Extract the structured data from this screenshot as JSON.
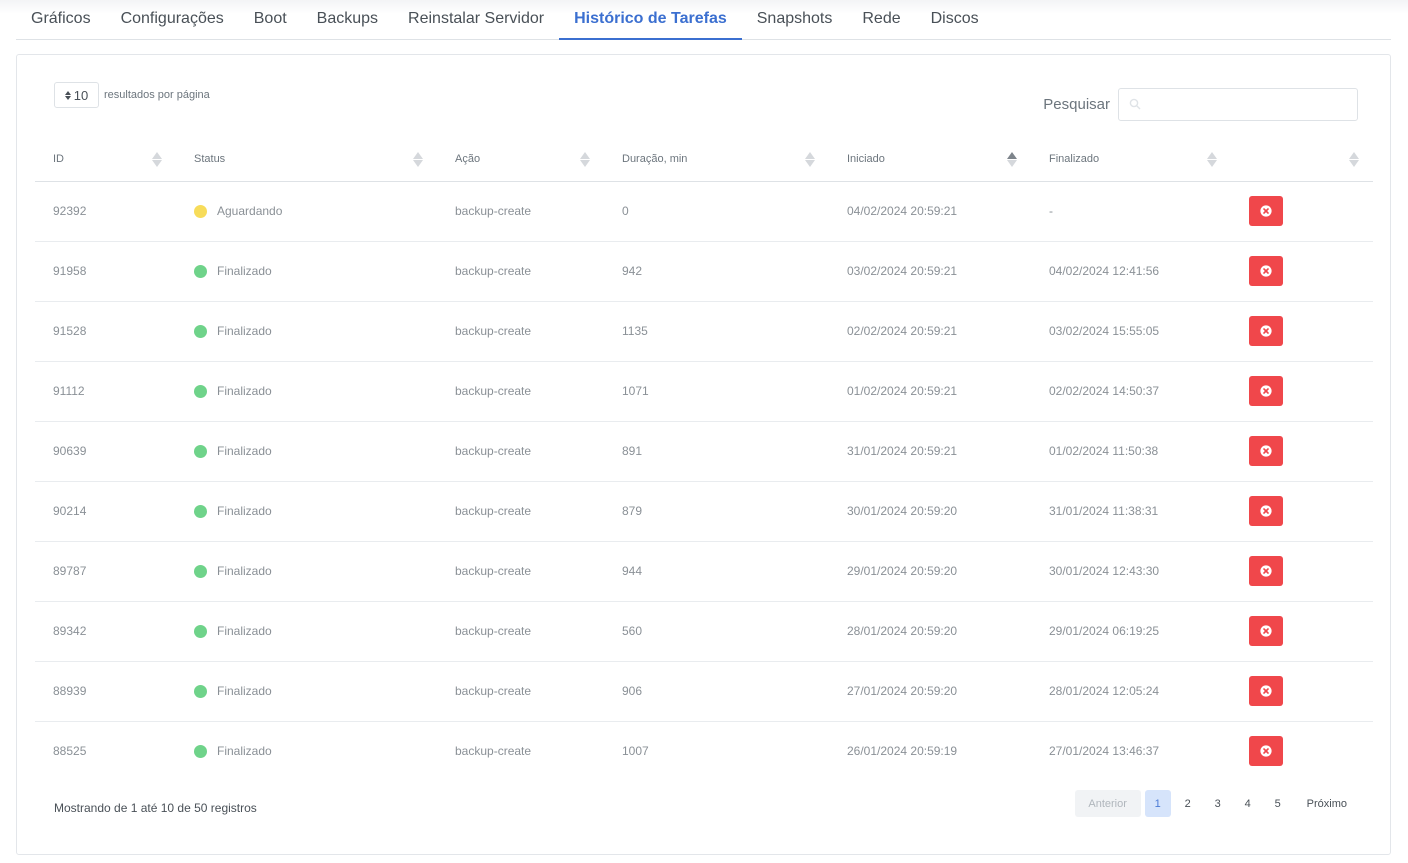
{
  "tabs": [
    {
      "label": "Gráficos",
      "active": false
    },
    {
      "label": "Configurações",
      "active": false
    },
    {
      "label": "Boot",
      "active": false
    },
    {
      "label": "Backups",
      "active": false
    },
    {
      "label": "Reinstalar Servidor",
      "active": false
    },
    {
      "label": "Histórico de Tarefas",
      "active": true
    },
    {
      "label": "Snapshots",
      "active": false
    },
    {
      "label": "Rede",
      "active": false
    },
    {
      "label": "Discos",
      "active": false
    }
  ],
  "length": {
    "value": "10",
    "label": "resultados por página"
  },
  "search": {
    "label": "Pesquisar",
    "value": ""
  },
  "columns": [
    {
      "label": "ID",
      "sort": "none"
    },
    {
      "label": "Status",
      "sort": "none"
    },
    {
      "label": "Ação",
      "sort": "none"
    },
    {
      "label": "Duração, min",
      "sort": "none"
    },
    {
      "label": "Iniciado",
      "sort": "asc"
    },
    {
      "label": "Finalizado",
      "sort": "none"
    },
    {
      "label": "",
      "sort": "none"
    }
  ],
  "rows": [
    {
      "id": "92392",
      "status": "Aguardando",
      "status_color": "#f7dc5a",
      "action": "backup-create",
      "duration": "0",
      "started": "04/02/2024 20:59:21",
      "finished": "-"
    },
    {
      "id": "91958",
      "status": "Finalizado",
      "status_color": "#6fd38a",
      "action": "backup-create",
      "duration": "942",
      "started": "03/02/2024 20:59:21",
      "finished": "04/02/2024 12:41:56"
    },
    {
      "id": "91528",
      "status": "Finalizado",
      "status_color": "#6fd38a",
      "action": "backup-create",
      "duration": "1135",
      "started": "02/02/2024 20:59:21",
      "finished": "03/02/2024 15:55:05"
    },
    {
      "id": "91112",
      "status": "Finalizado",
      "status_color": "#6fd38a",
      "action": "backup-create",
      "duration": "1071",
      "started": "01/02/2024 20:59:21",
      "finished": "02/02/2024 14:50:37"
    },
    {
      "id": "90639",
      "status": "Finalizado",
      "status_color": "#6fd38a",
      "action": "backup-create",
      "duration": "891",
      "started": "31/01/2024 20:59:21",
      "finished": "01/02/2024 11:50:38"
    },
    {
      "id": "90214",
      "status": "Finalizado",
      "status_color": "#6fd38a",
      "action": "backup-create",
      "duration": "879",
      "started": "30/01/2024 20:59:20",
      "finished": "31/01/2024 11:38:31"
    },
    {
      "id": "89787",
      "status": "Finalizado",
      "status_color": "#6fd38a",
      "action": "backup-create",
      "duration": "944",
      "started": "29/01/2024 20:59:20",
      "finished": "30/01/2024 12:43:30"
    },
    {
      "id": "89342",
      "status": "Finalizado",
      "status_color": "#6fd38a",
      "action": "backup-create",
      "duration": "560",
      "started": "28/01/2024 20:59:20",
      "finished": "29/01/2024 06:19:25"
    },
    {
      "id": "88939",
      "status": "Finalizado",
      "status_color": "#6fd38a",
      "action": "backup-create",
      "duration": "906",
      "started": "27/01/2024 20:59:20",
      "finished": "28/01/2024 12:05:24"
    },
    {
      "id": "88525",
      "status": "Finalizado",
      "status_color": "#6fd38a",
      "action": "backup-create",
      "duration": "1007",
      "started": "26/01/2024 20:59:19",
      "finished": "27/01/2024 13:46:37"
    }
  ],
  "footer": {
    "info": "Mostrando de 1 até 10 de 50 registros",
    "prev_label": "Anterior",
    "next_label": "Próximo",
    "pages": [
      "1",
      "2",
      "3",
      "4",
      "5"
    ],
    "active_page": "1"
  },
  "colors": {
    "accent": "#3b6fd0",
    "danger": "#f0474b",
    "waiting": "#f7dc5a",
    "done": "#6fd38a"
  },
  "icons": {
    "row_action": "close-circle-icon",
    "search": "search-icon",
    "length_arrows": "sort-updown-icon"
  }
}
